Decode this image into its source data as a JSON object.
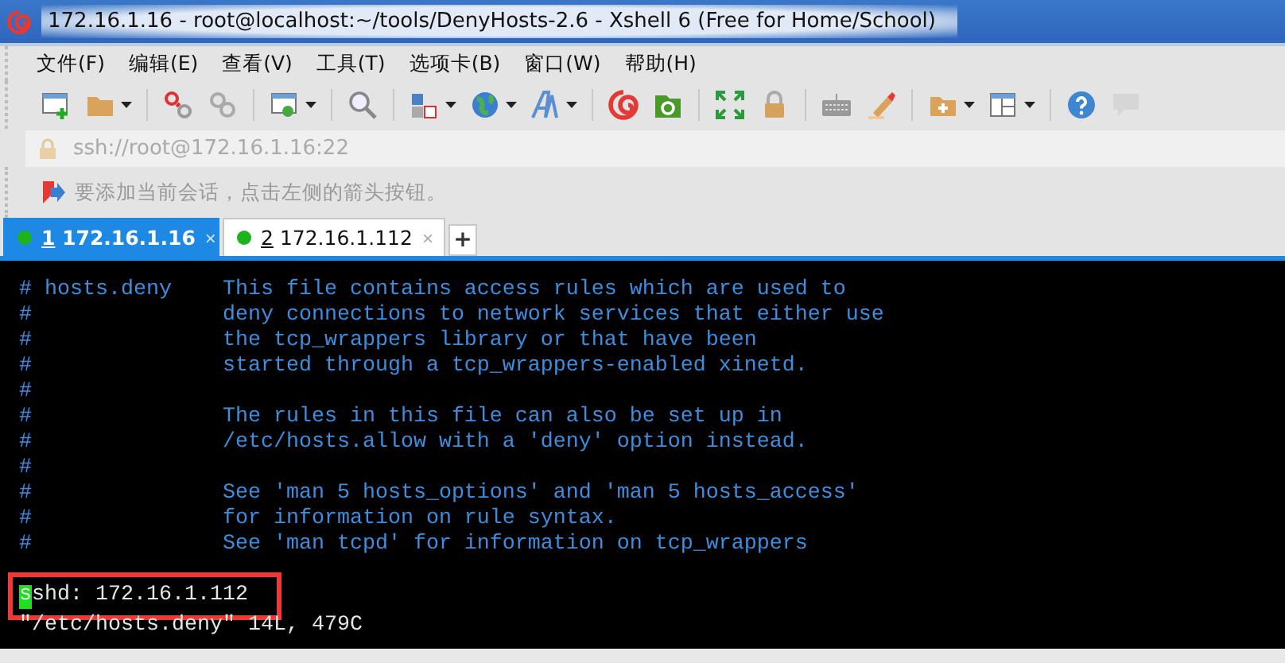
{
  "window": {
    "title": "172.16.1.16 - root@localhost:~/tools/DenyHosts-2.6 - Xshell 6 (Free for Home/School)"
  },
  "menu": [
    "文件(F)",
    "编辑(E)",
    "查看(V)",
    "工具(T)",
    "选项卡(B)",
    "窗口(W)",
    "帮助(H)"
  ],
  "address_bar": {
    "value": "ssh://root@172.16.1.16:22"
  },
  "hint_bar": {
    "text": "要添加当前会话，点击左侧的箭头按钮。"
  },
  "tabs": [
    {
      "key": "1",
      "label": "172.16.1.16",
      "selected": true,
      "color": "#1db31d",
      "close": "×"
    },
    {
      "key": "2",
      "label": "172.16.1.112",
      "selected": false,
      "color": "#1db31d",
      "close": "×"
    }
  ],
  "new_tab": "+",
  "terminal": {
    "lines": [
      {
        "kind": "comment",
        "text": "# hosts.deny    This file contains access rules which are used to"
      },
      {
        "kind": "comment",
        "text": "#               deny connections to network services that either use"
      },
      {
        "kind": "comment",
        "text": "#               the tcp_wrappers library or that have been"
      },
      {
        "kind": "comment",
        "text": "#               started through a tcp_wrappers-enabled xinetd."
      },
      {
        "kind": "comment",
        "text": "#"
      },
      {
        "kind": "comment",
        "text": "#               The rules in this file can also be set up in"
      },
      {
        "kind": "comment",
        "text": "#               /etc/hosts.allow with a 'deny' option instead."
      },
      {
        "kind": "comment",
        "text": "#"
      },
      {
        "kind": "comment",
        "text": "#               See 'man 5 hosts_options' and 'man 5 hosts_access'"
      },
      {
        "kind": "comment",
        "text": "#               for information on rule syntax."
      },
      {
        "kind": "comment",
        "text": "#               See 'man tcpd' for information on tcp_wrappers"
      },
      {
        "kind": "text",
        "text": "sshd: 172.16.1.112",
        "cursor": true,
        "highlighted": true
      },
      {
        "kind": "text",
        "text": "\"/etc/hosts.deny\" 14L, 479C"
      }
    ]
  }
}
